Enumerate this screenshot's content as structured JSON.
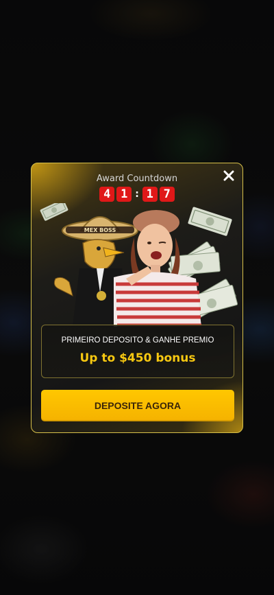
{
  "modal": {
    "countdown_title": "Award Countdown",
    "countdown_digits": [
      "4",
      "1",
      "1",
      "7"
    ],
    "countdown_separator": ":",
    "hero_hat_text": "MEX BOSS",
    "promo_title": "PRIMEIRO DEPOSITO & GANHE PREMIO",
    "promo_bonus": "Up to $450 bonus",
    "cta_label": "DEPOSITE AGORA",
    "close_icon": "close-icon"
  },
  "colors": {
    "accent_gold": "#f7c811",
    "button_bg": "#ffc700",
    "digit_bg": "#e01818",
    "border": "#d8c14a"
  }
}
